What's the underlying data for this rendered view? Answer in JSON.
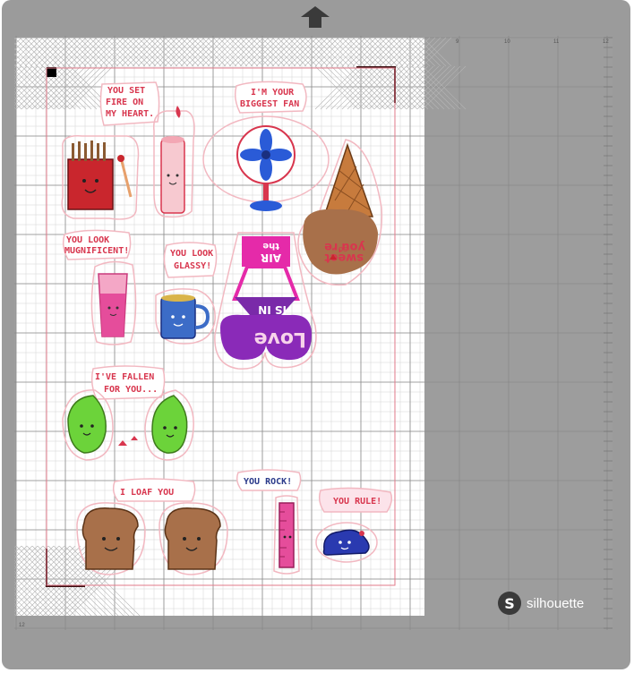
{
  "brand": {
    "name": "silhouette",
    "logo_letter": "S"
  },
  "ruler": {
    "top_numbers": [
      "9",
      "10",
      "11",
      "12"
    ],
    "left_number": "12"
  },
  "stickers": {
    "fire": {
      "text": [
        "YOU SET",
        "FIRE ON",
        "MY HEART."
      ]
    },
    "fan": {
      "text": [
        "I'M YOUR",
        "BIGGEST FAN"
      ]
    },
    "icecream": {
      "text": [
        "you're",
        "so",
        "sweet"
      ]
    },
    "magnificent": {
      "text": [
        "YOU LOOK",
        "MUGNIFICENT!"
      ]
    },
    "glassy": {
      "text": [
        "YOU LOOK",
        "GLASSY!"
      ]
    },
    "love": {
      "text": [
        "the",
        "AIR",
        "IS IN",
        "Love"
      ]
    },
    "fallen": {
      "text": [
        "I'VE FALLEN",
        "FOR YOU..."
      ]
    },
    "loaf": {
      "text": [
        "I LOAF YOU"
      ]
    },
    "rock": {
      "text": [
        "YOU ROCK!"
      ]
    },
    "rule": {
      "text": [
        "YOU RULE!"
      ]
    }
  },
  "colors": {
    "mat": "#9b9b9b",
    "grid": "#bcbcbc",
    "registration": "#000000",
    "cut_line": "#e27a8a",
    "accent_red": "#d8364e"
  }
}
